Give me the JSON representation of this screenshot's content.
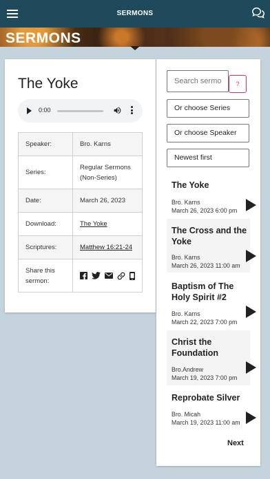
{
  "header": {
    "title": "SERMONS",
    "menu_icon": "hamburger-menu-icon",
    "chat_icon": "chat-bubbles-icon"
  },
  "banner": {
    "title": "SERMONS"
  },
  "sermon_detail": {
    "title": "The Yoke",
    "audio": {
      "time": "0:00"
    },
    "rows": {
      "speaker": {
        "label": "Speaker:",
        "value": "Bro. Karns"
      },
      "series": {
        "label": "Series:",
        "value": "Regular Sermons (Non-Series)"
      },
      "date": {
        "label": "Date:",
        "value": "March 26, 2023"
      },
      "download": {
        "label": "Download:",
        "value": "The Yoke"
      },
      "scriptures": {
        "label": "Scriptures:",
        "value": "Matthew 16:21-24"
      },
      "share": {
        "label": "Share this sermon:"
      }
    }
  },
  "sidebar": {
    "search_placeholder": "Search sermons",
    "help_label": "?",
    "series_select": "Or choose Series",
    "speaker_select": "Or choose Speaker",
    "sort_select": "Newest first",
    "sermons": [
      {
        "title": "The Yoke",
        "speaker": "Bro. Karns",
        "date": "March 26, 2023 6:00 pm"
      },
      {
        "title": "The Cross and the Yoke",
        "speaker": "Bro. Karns",
        "date": "March 26, 2023 11:00 am"
      },
      {
        "title": "Baptism of The Holy Spirit #2",
        "speaker": "Bro. Karns",
        "date": "March 22, 2023 7:00 pm"
      },
      {
        "title": "Christ the Foundation",
        "speaker": "Bro.Andrew",
        "date": "March 19, 2023 7:00 pm"
      },
      {
        "title": "Reprobate Silver",
        "speaker": "Bro. Micah",
        "date": "March 19, 2023 11:00 am"
      }
    ],
    "next_label": "Next"
  },
  "colors": {
    "topbar": "#1e4a5c",
    "page_bg": "#c5d3dc",
    "accent": "#e0305a"
  }
}
